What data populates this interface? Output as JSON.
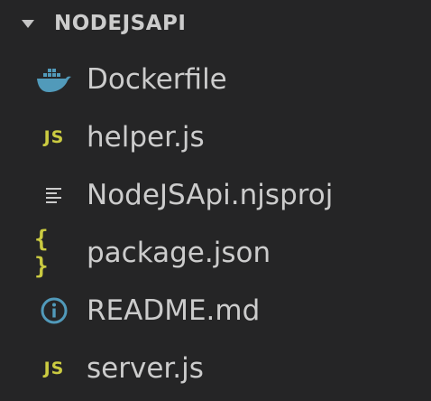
{
  "explorer": {
    "folder_name": "NODEJSAPI",
    "files": [
      {
        "name": "Dockerfile",
        "icon": "docker-icon",
        "color": "#519aba"
      },
      {
        "name": "helper.js",
        "icon": "javascript-icon",
        "icon_text": "JS",
        "color": "#cbcb41"
      },
      {
        "name": "NodeJSApi.njsproj",
        "icon": "lines-file-icon",
        "color": "#cccccc"
      },
      {
        "name": "package.json",
        "icon": "json-icon",
        "icon_text": "{ }",
        "color": "#cbcb41"
      },
      {
        "name": "README.md",
        "icon": "info-icon",
        "color": "#519aba"
      },
      {
        "name": "server.js",
        "icon": "javascript-icon",
        "icon_text": "JS",
        "color": "#cbcb41"
      }
    ]
  }
}
